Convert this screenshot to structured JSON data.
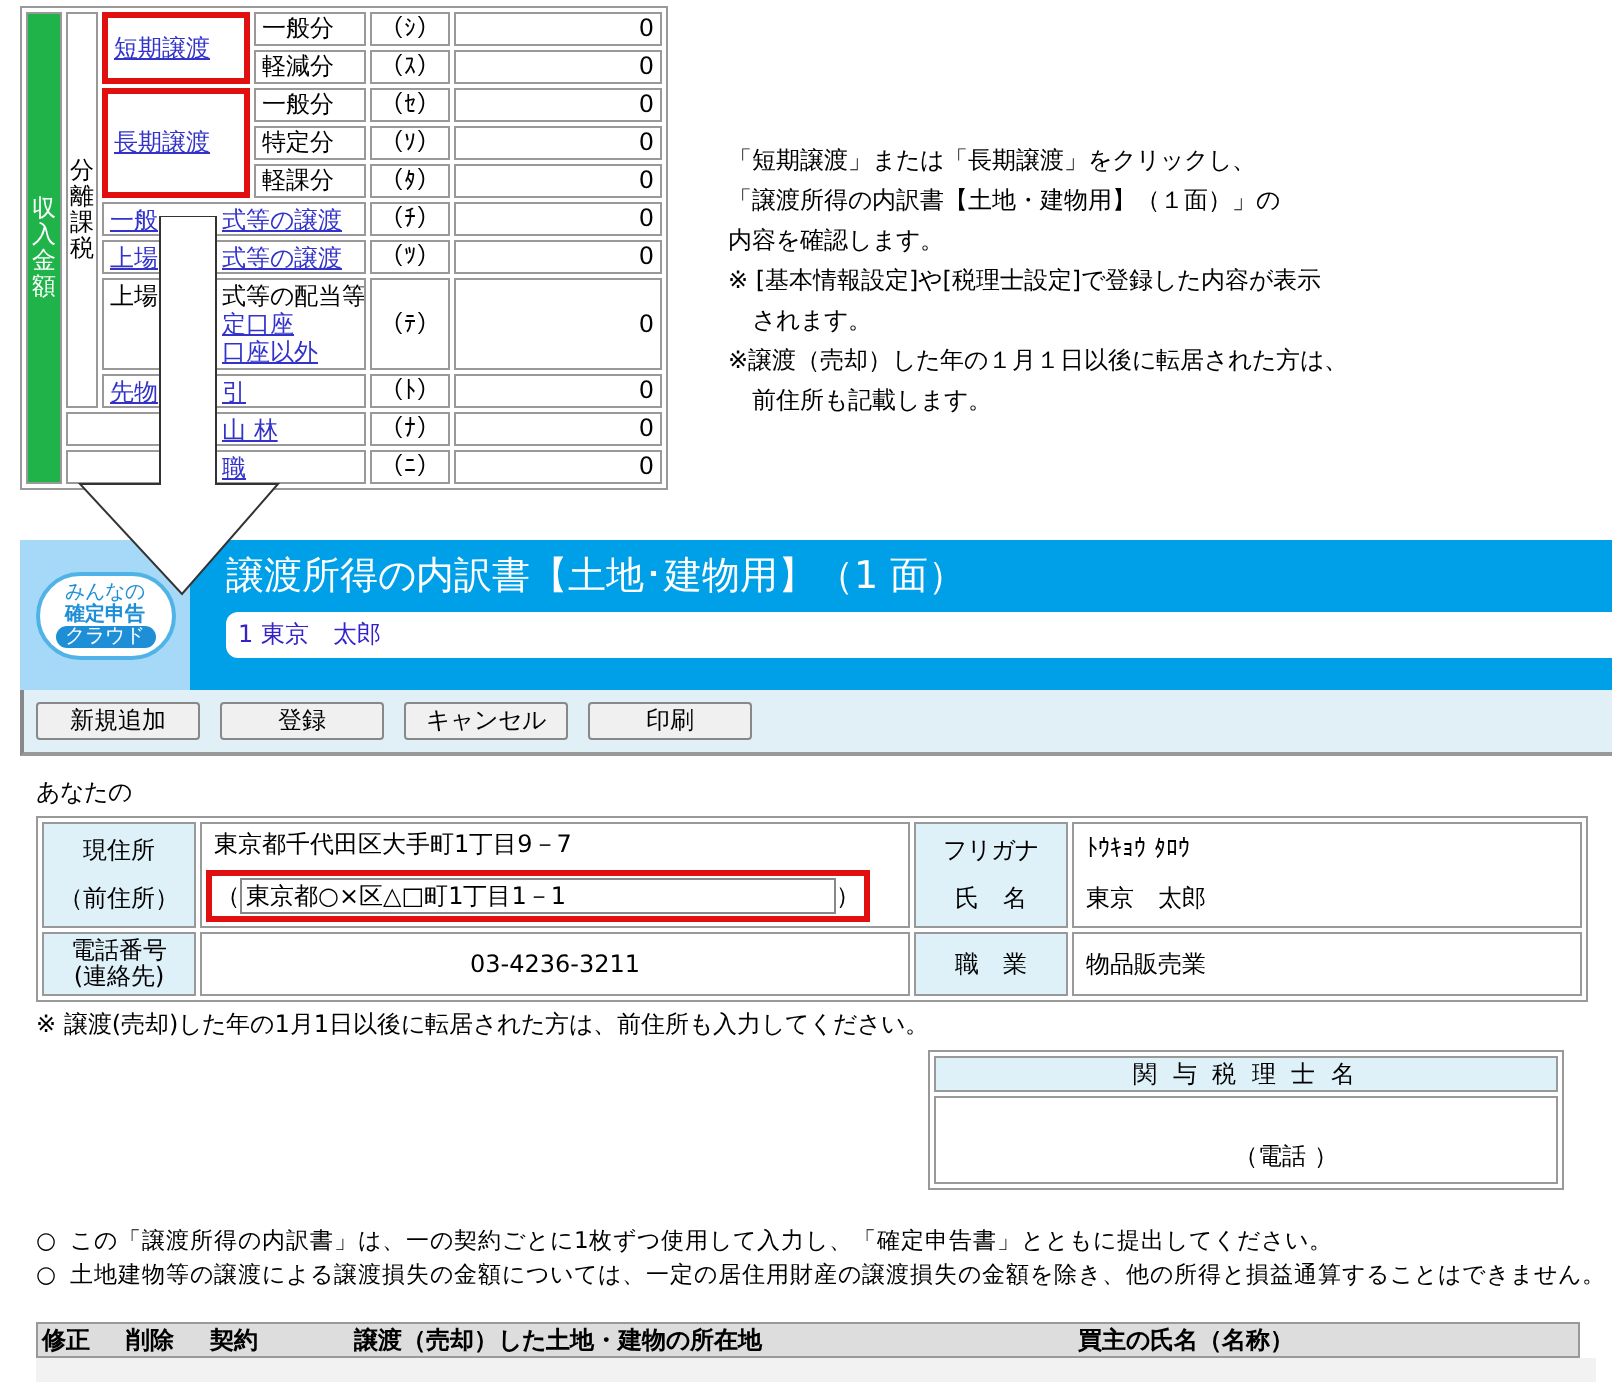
{
  "income_table": {
    "side_label": "収入金額",
    "group_label": "分離課税",
    "highlighted": true,
    "transfer_groups": [
      {
        "link": "短期譲渡",
        "rows": [
          {
            "label": "一般分",
            "code": "（ｼ）",
            "value": "0"
          },
          {
            "label": "軽減分",
            "code": "（ｽ）",
            "value": "0"
          }
        ]
      },
      {
        "link": "長期譲渡",
        "rows": [
          {
            "label": "一般分",
            "code": "（ｾ）",
            "value": "0"
          },
          {
            "label": "特定分",
            "code": "（ｿ）",
            "value": "0"
          },
          {
            "label": "軽課分",
            "code": "（ﾀ）",
            "value": "0"
          }
        ]
      }
    ],
    "other_rows": [
      {
        "in_group": true,
        "lines": [
          {
            "kind": "link",
            "before": "一般",
            "after": "式等の譲渡"
          }
        ],
        "code": "（ﾁ）",
        "value": "0"
      },
      {
        "in_group": true,
        "lines": [
          {
            "kind": "link",
            "before": "上場",
            "after": "式等の譲渡"
          }
        ],
        "code": "（ﾂ）",
        "value": "0"
      },
      {
        "in_group": true,
        "lines": [
          {
            "kind": "text",
            "before": "上場",
            "after": "式等の配当等"
          },
          {
            "kind": "link",
            "after": "定口座"
          },
          {
            "kind": "link",
            "after": "口座以外"
          }
        ],
        "code": "（ﾃ）",
        "value": "0"
      },
      {
        "in_group": true,
        "lines": [
          {
            "kind": "link",
            "before": "先物",
            "after": "引"
          }
        ],
        "code": "（ﾄ）",
        "value": "0"
      },
      {
        "in_group": false,
        "lines": [
          {
            "kind": "link",
            "after": "山 林"
          }
        ],
        "code": "（ﾅ）",
        "value": "0"
      },
      {
        "in_group": false,
        "lines": [
          {
            "kind": "link",
            "after": "職"
          }
        ],
        "code": "（ﾆ）",
        "value": "0"
      }
    ]
  },
  "instructions": [
    "「短期譲渡」または「長期譲渡」をクリックし、",
    "「譲渡所得の内訳書【土地・建物用】（１面）」の",
    "内容を確認します。",
    "※ [基本情報設定]や[税理士設定]で登録した内容が表示",
    "　されます。",
    "※譲渡（売却）した年の１月１日以後に転居された方は、",
    "　前住所も記載します。"
  ],
  "window": {
    "logo": {
      "top": "みんなの",
      "middle": "確定申告",
      "bottom": "クラウド"
    },
    "title": "譲渡所得の内訳書【土地･建物用】（1 面）",
    "user": "1 東京　太郎",
    "toolbar": [
      "新規追加",
      "登録",
      "キャンセル",
      "印刷"
    ],
    "section_label": "あなたの",
    "form": {
      "address_label": "現住所",
      "previous_address_label": "（前住所）",
      "address": "東京都千代田区大手町1丁目9－7",
      "previous_address": {
        "open": "（",
        "value": "東京都○×区△□町1丁目1－1",
        "close": "）",
        "highlighted": true
      },
      "furigana_label": "フリガナ",
      "furigana": "ﾄｳｷｮｳ ﾀﾛｳ",
      "name_label": "氏　名",
      "name": "東京　太郎",
      "phone_label": "電話番号",
      "phone_sublabel": "(連絡先)",
      "phone": "03-4236-3211",
      "occupation_label": "職　業",
      "occupation": "物品販売業"
    },
    "form_note": "※ 譲渡(売却)した年の1月1日以後に転居された方は、前住所も入力してください。",
    "accountant": {
      "header": "関 与 税 理 士 名",
      "phone": "（電話 ）"
    },
    "notes": [
      {
        "marker": "○",
        "text": "この「譲渡所得の内訳書」は、一の契約ごとに1枚ずつ使用して入力し、「確定申告書」とともに提出してください。"
      },
      {
        "marker": "○",
        "text": "土地建物等の譲渡による譲渡損失の金額については、一定の居住用財産の譲渡損失の金額を除き、他の所得と損益通算することはできません。"
      }
    ],
    "list_columns": [
      "修正",
      "削除",
      "契約",
      "譲渡（売却）した土地・建物の所在地",
      "買主の氏名（名称）"
    ]
  }
}
